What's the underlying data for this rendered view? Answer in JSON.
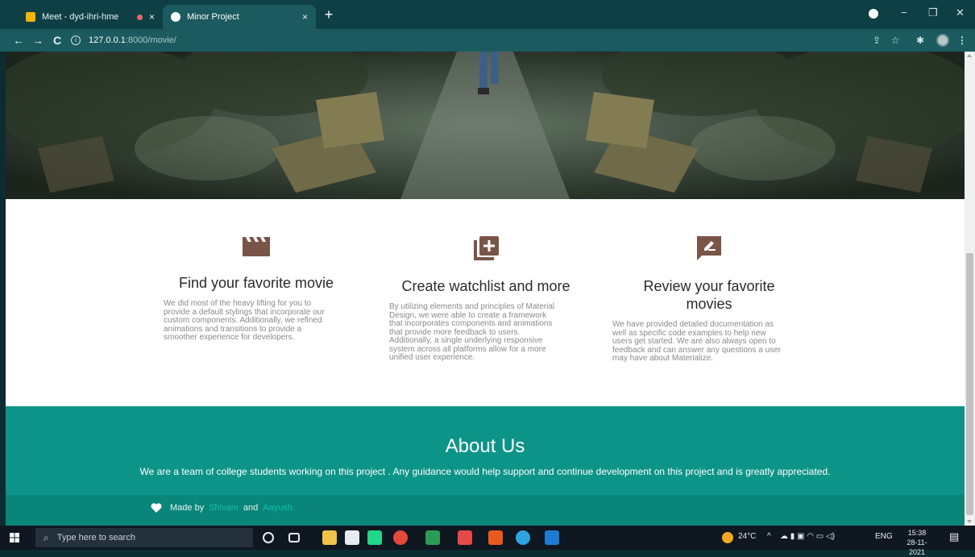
{
  "browser": {
    "tabs": [
      {
        "title": "Meet - dyd-ihri-hme",
        "close": "×"
      },
      {
        "title": "Minor Project",
        "close": "×"
      }
    ],
    "new_tab": "+",
    "window": {
      "minimize": "−",
      "restore": "❐",
      "close": "✕"
    },
    "nav": {
      "back": "←",
      "forward": "→",
      "reload": "C"
    },
    "address": {
      "info": "i",
      "host": "127.0.0.1",
      "path": ":8000/movie/"
    },
    "toolbar_icons": {
      "share": "⇪",
      "bookmark": "☆",
      "extensions": "✱",
      "menu": "⋮"
    }
  },
  "features": [
    {
      "icon": "movie-clapper-icon",
      "title": "Find your favorite movie",
      "lines": [
        "We did most of the heavy lifting for you to",
        "provide a default stylings that incorporate our",
        "custom components. Additionally, we refined",
        "animations and transitions to provide a",
        "smoother experience for developers."
      ]
    },
    {
      "icon": "library-add-icon",
      "title": "Create watchlist and more",
      "lines": [
        "By utilizing elements and principles of Material",
        "Design, we were able to create a framework",
        "that incorporates components and animations",
        "that provide more feedback to users.",
        "Additionally, a single underlying responsive",
        "system across all platforms allow for a more",
        "unified user experience."
      ]
    },
    {
      "icon": "rate-review-icon",
      "title_lines": [
        "Review your favorite",
        "movies"
      ],
      "lines": [
        "We have provided detailed documentation as",
        "well as specific code examples to help new",
        "users get started. We are also always open to",
        "feedback and can answer any questions a user",
        "may have about Materialize."
      ]
    }
  ],
  "about": {
    "title": "About Us",
    "text": "We are a team of college students working on this project . Any guidance would help support and continue development on this project and is greatly appreciated."
  },
  "footer": {
    "made_by": "Made by",
    "name1": "Shivam",
    "and": "and",
    "name2": "Aayush"
  },
  "taskbar": {
    "search_placeholder": "Type here to search",
    "weather": "24°C",
    "language": "ENG",
    "time": "15:38",
    "date": "28-11-2021"
  },
  "colors": {
    "accent": "#0d9488",
    "icon_brown": "#795548",
    "chrome": "#1b5a5e"
  }
}
